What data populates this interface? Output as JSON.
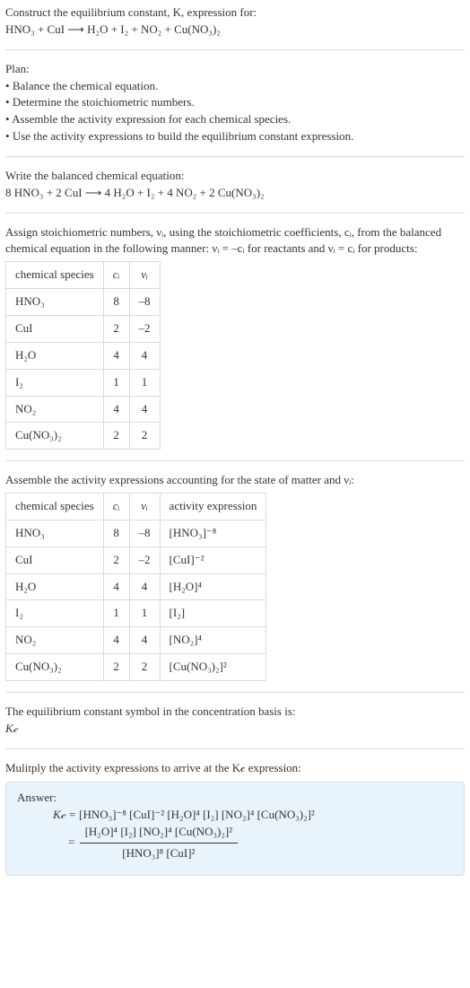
{
  "intro": {
    "line1": "Construct the equilibrium constant, K, expression for:",
    "equation": "HNO₃ + CuI ⟶ H₂O + I₂ + NO₂ + Cu(NO₃)₂"
  },
  "plan": {
    "heading": "Plan:",
    "items": [
      "Balance the chemical equation.",
      "Determine the stoichiometric numbers.",
      "Assemble the activity expression for each chemical species.",
      "Use the activity expressions to build the equilibrium constant expression."
    ]
  },
  "balanced": {
    "heading": "Write the balanced chemical equation:",
    "equation": "8 HNO₃ + 2 CuI ⟶ 4 H₂O + I₂ + 4 NO₂ + 2 Cu(NO₃)₂"
  },
  "assign": {
    "text1": "Assign stoichiometric numbers, νᵢ, using the stoichiometric coefficients, cᵢ, from the balanced chemical equation in the following manner: νᵢ = –cᵢ for reactants and νᵢ = cᵢ for products:"
  },
  "table1": {
    "headers": {
      "species": "chemical species",
      "ci": "cᵢ",
      "vi": "νᵢ"
    },
    "rows": [
      {
        "species": "HNO₃",
        "ci": "8",
        "vi": "–8"
      },
      {
        "species": "CuI",
        "ci": "2",
        "vi": "–2"
      },
      {
        "species": "H₂O",
        "ci": "4",
        "vi": "4"
      },
      {
        "species": "I₂",
        "ci": "1",
        "vi": "1"
      },
      {
        "species": "NO₂",
        "ci": "4",
        "vi": "4"
      },
      {
        "species": "Cu(NO₃)₂",
        "ci": "2",
        "vi": "2"
      }
    ]
  },
  "assemble": {
    "text": "Assemble the activity expressions accounting for the state of matter and νᵢ:"
  },
  "table2": {
    "headers": {
      "species": "chemical species",
      "ci": "cᵢ",
      "vi": "νᵢ",
      "activity": "activity expression"
    },
    "rows": [
      {
        "species": "HNO₃",
        "ci": "8",
        "vi": "–8",
        "activity": "[HNO₃]⁻⁸"
      },
      {
        "species": "CuI",
        "ci": "2",
        "vi": "–2",
        "activity": "[CuI]⁻²"
      },
      {
        "species": "H₂O",
        "ci": "4",
        "vi": "4",
        "activity": "[H₂O]⁴"
      },
      {
        "species": "I₂",
        "ci": "1",
        "vi": "1",
        "activity": "[I₂]"
      },
      {
        "species": "NO₂",
        "ci": "4",
        "vi": "4",
        "activity": "[NO₂]⁴"
      },
      {
        "species": "Cu(NO₃)₂",
        "ci": "2",
        "vi": "2",
        "activity": "[Cu(NO₃)₂]²"
      }
    ]
  },
  "symbol": {
    "line1": "The equilibrium constant symbol in the concentration basis is:",
    "line2": "K𝒸"
  },
  "multiply": {
    "text": "Mulitply the activity expressions to arrive at the K𝒸 expression:"
  },
  "answer": {
    "label": "Answer:",
    "lhs": "K𝒸 = ",
    "rhs_line1": "[HNO₃]⁻⁸ [CuI]⁻² [H₂O]⁴ [I₂] [NO₂]⁴ [Cu(NO₃)₂]²",
    "eq": " = ",
    "num": "[H₂O]⁴ [I₂] [NO₂]⁴ [Cu(NO₃)₂]²",
    "den": "[HNO₃]⁸ [CuI]²"
  }
}
